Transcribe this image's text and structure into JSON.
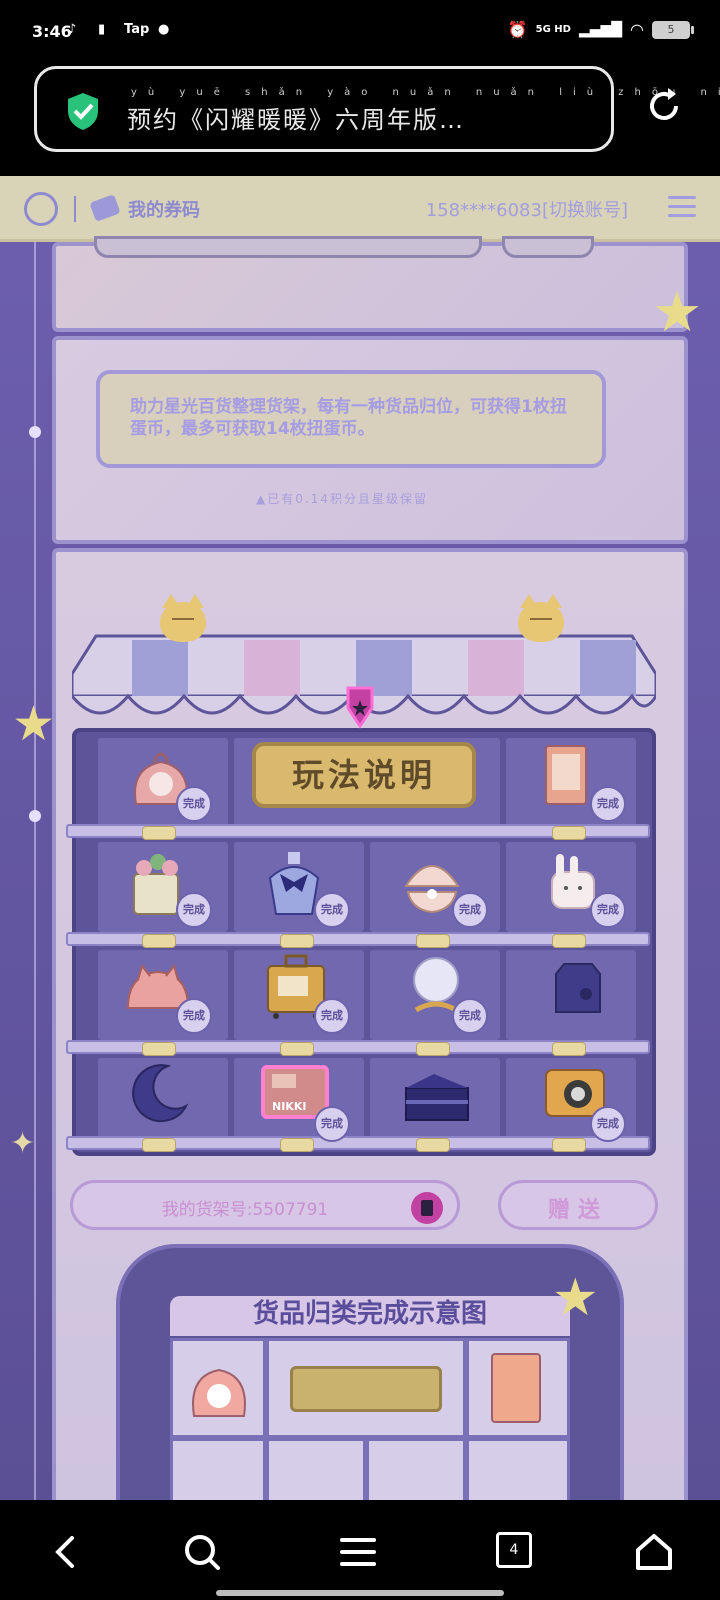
{
  "status_bar": {
    "time": "3:46",
    "apps": [
      "TikTok",
      "File",
      "Tap",
      "QQ"
    ],
    "network": "5G HD",
    "battery": "5"
  },
  "browser": {
    "title": "预约《闪耀暖暖》六周年版…",
    "title_pinyin": "yù yuē shǎn yào nuǎn nuǎn liù zhōu nián bǎn",
    "tab_count": "4"
  },
  "page_nav": {
    "coupon_label": "我的券码",
    "account_label": "158****6083[切换账号]"
  },
  "info_card": {
    "rule_text": "助力星光百货整理货架，每有一种货品归位，可获得1枚扭蛋币，最多可获取14枚扭蛋币。",
    "sub_text": "▲已有0.14积分且星级保留"
  },
  "shop": {
    "howto_label": "玩法说明",
    "done_label": "完成",
    "shelf_id_label": "我的货架号:5507791",
    "gift_label": "赠送",
    "preview_title": "货品归类完成示意图",
    "rows": [
      [
        {
          "item": "bunny backpack",
          "done": true
        },
        {
          "item": "how-to sign",
          "done": false
        },
        {
          "item": "notebook",
          "done": true
        }
      ],
      [
        {
          "item": "flower basket",
          "done": true
        },
        {
          "item": "bow perfume",
          "done": true
        },
        {
          "item": "pearl shell",
          "done": true
        },
        {
          "item": "bunny mug",
          "done": true
        }
      ],
      [
        {
          "item": "cat hat",
          "done": true
        },
        {
          "item": "suitcase",
          "done": true
        },
        {
          "item": "crystal ball",
          "done": true
        },
        {
          "item": "milk box",
          "done": false
        }
      ],
      [
        {
          "item": "moon pillow",
          "done": false
        },
        {
          "item": "nikki box",
          "done": true
        },
        {
          "item": "cake",
          "done": false
        },
        {
          "item": "camera",
          "done": true
        }
      ]
    ],
    "nikki_label": "NIKKI"
  },
  "colors": {
    "page_bg": "#5b4f96",
    "accent_pink": "#c341a3",
    "gold": "#d9b96e"
  }
}
